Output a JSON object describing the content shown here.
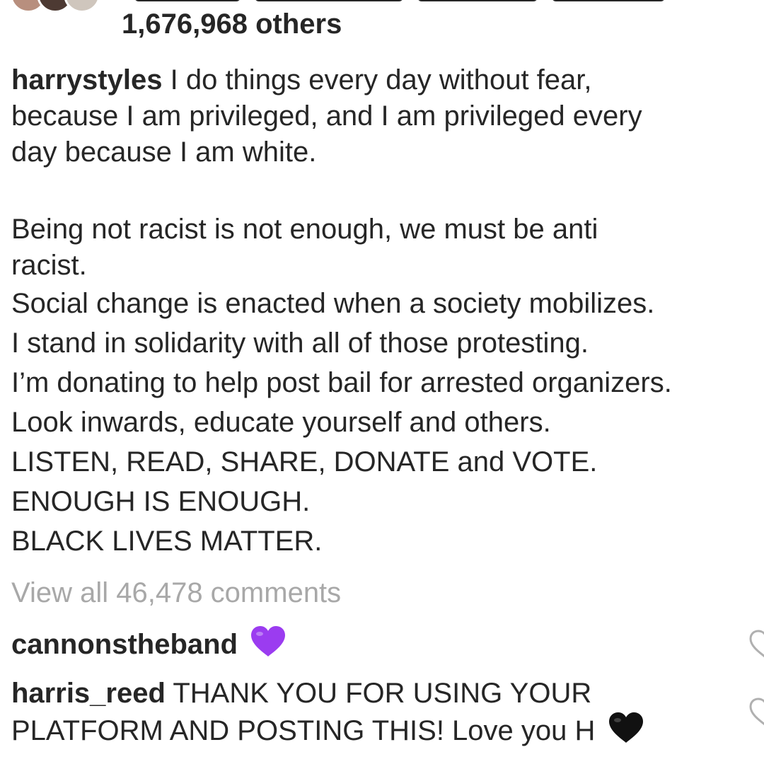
{
  "likes": {
    "count_text": "1,676,968 others"
  },
  "caption": {
    "username": "harrystyles",
    "lines": [
      "I do things every day without fear,",
      "because I am privileged, and I am privileged every",
      "day because I am white.",
      "Being not racist is not enough, we must be anti",
      "racist.",
      "Social change is enacted when a society mobilizes.",
      "I stand in solidarity with all of those protesting.",
      "I’m donating to help post bail for arrested organizers.",
      "Look inwards, educate yourself and others.",
      "LISTEN, READ, SHARE, DONATE and VOTE.",
      "ENOUGH IS ENOUGH.",
      "BLACK LIVES MATTER."
    ]
  },
  "comments_link": {
    "label": "View all 46,478 comments"
  },
  "comments": [
    {
      "username": "cannonstheband",
      "text": "",
      "emoji": "purple-heart",
      "emoji_color": "#9b3cf0"
    },
    {
      "username": "harris_reed",
      "line1": "THANK YOU FOR USING YOUR",
      "line2": "PLATFORM AND POSTING THIS! Love you H",
      "emoji": "black-heart",
      "emoji_color": "#111111"
    }
  ],
  "icons": {
    "like": "heart-outline-icon",
    "avatars": "avatar"
  }
}
